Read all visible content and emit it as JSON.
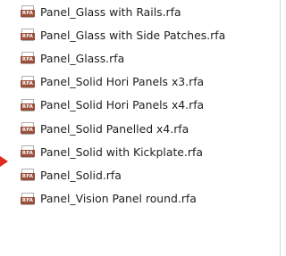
{
  "file_list": {
    "items": [
      {
        "name": "Panel_Glass with Rails.rfa",
        "icon": "rfa-file-icon",
        "icon_text": "RFA"
      },
      {
        "name": "Panel_Glass with Side Patches.rfa",
        "icon": "rfa-file-icon",
        "icon_text": "RFA"
      },
      {
        "name": "Panel_Glass.rfa",
        "icon": "rfa-file-icon",
        "icon_text": "RFA"
      },
      {
        "name": "Panel_Solid Hori Panels x3.rfa",
        "icon": "rfa-file-icon",
        "icon_text": "RFA"
      },
      {
        "name": "Panel_Solid Hori Panels x4.rfa",
        "icon": "rfa-file-icon",
        "icon_text": "RFA"
      },
      {
        "name": "Panel_Solid Panelled x4.rfa",
        "icon": "rfa-file-icon",
        "icon_text": "RFA"
      },
      {
        "name": "Panel_Solid with Kickplate.rfa",
        "icon": "rfa-file-icon",
        "icon_text": "RFA"
      },
      {
        "name": "Panel_Solid.rfa",
        "icon": "rfa-file-icon",
        "icon_text": "RFA"
      },
      {
        "name": "Panel_Vision Panel round.rfa",
        "icon": "rfa-file-icon",
        "icon_text": "RFA"
      }
    ]
  },
  "pointer": {
    "icon": "red-arrow-pointer-icon",
    "color": "#e02a1c"
  },
  "colors": {
    "icon_band": "#9a4f3a",
    "text": "#1e1e1e",
    "background": "#ffffff"
  }
}
